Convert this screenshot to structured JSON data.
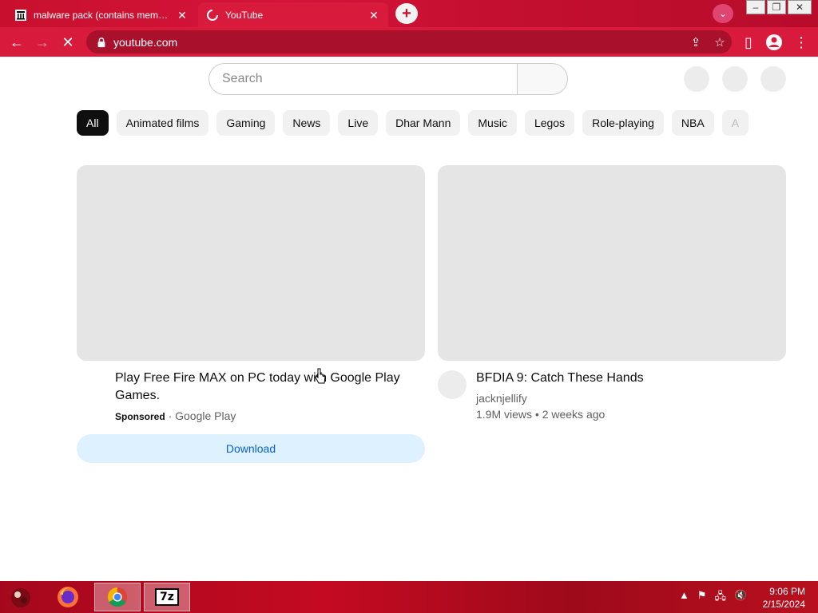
{
  "browser": {
    "tabs": [
      {
        "title": "malware pack (contains memz) :",
        "active": false
      },
      {
        "title": "YouTube",
        "active": true
      }
    ],
    "url": "youtube.com",
    "theme_color": "#d81b3c"
  },
  "youtube": {
    "search": {
      "placeholder": "Search"
    },
    "chips": [
      "All",
      "Animated films",
      "Gaming",
      "News",
      "Live",
      "Dhar Mann",
      "Music",
      "Legos",
      "Role-playing",
      "NBA",
      "A"
    ],
    "ad": {
      "title": "Play Free Fire MAX on PC today with Google Play Games.",
      "sponsored_label": "Sponsored",
      "separator": "·",
      "advertiser": "Google Play",
      "cta": "Download"
    },
    "video": {
      "title": "BFDIA 9: Catch These Hands",
      "channel": "jacknjellify",
      "stats": "1.9M views • 2 weeks ago"
    }
  },
  "taskbar": {
    "apps": [
      "start-orb",
      "firefox",
      "chrome",
      "7zip"
    ],
    "seven_zip_label": "7z",
    "clock": {
      "time": "9:06 PM",
      "date": "2/15/2024"
    }
  }
}
